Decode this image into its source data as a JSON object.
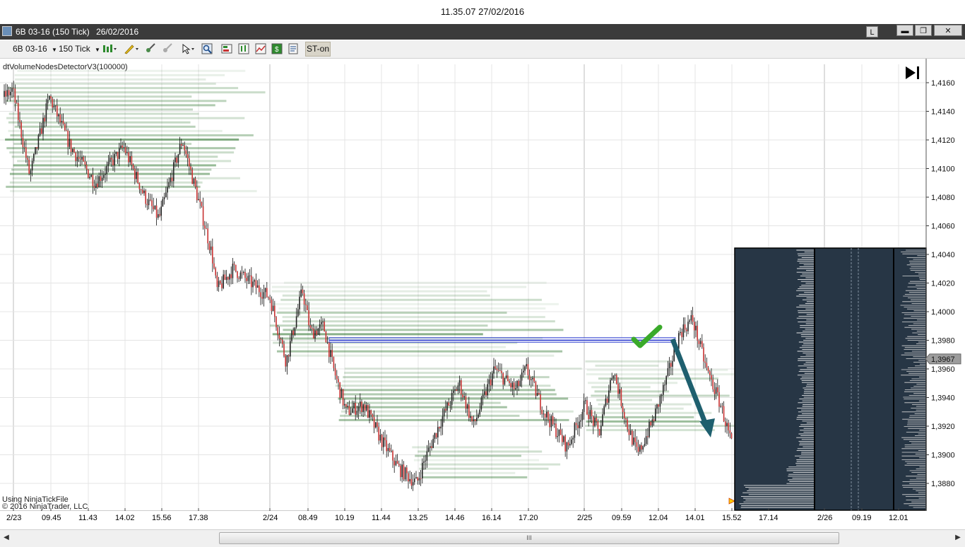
{
  "timestamp": "11.35.07 27/02/2016",
  "window": {
    "title": "6B 03-16 (150 Tick)",
    "date": "26/02/2016",
    "link_button": "L",
    "minimize": "▬",
    "restore": "❐",
    "close": "✕"
  },
  "toolbar": {
    "instrument": "6B 03-16",
    "interval": "150 Tick",
    "st_button": "ST-on",
    "icons": [
      "bars-type-icon",
      "drawing-pencil-icon",
      "crosshair-icon",
      "magnet-icon",
      "pointer-icon",
      "zoom-icon",
      "data-box-icon",
      "chart-style-icon",
      "indicators-icon",
      "strategy-icon",
      "properties-icon"
    ]
  },
  "chart": {
    "indicator_label": "dtVolumeNodesDetectorV3(100000)",
    "data_source": "Using NinjaTickFile",
    "copyright": "© 2016 NinjaTrader, LLC",
    "current_price_label": "1,3967",
    "price_ticks": [
      "1,4160",
      "1,4140",
      "1,4120",
      "1,4100",
      "1,4080",
      "1,4060",
      "1,4040",
      "1,4020",
      "1,4000",
      "1,3980",
      "1,3960",
      "1,3940",
      "1,3920",
      "1,3900",
      "1,3880"
    ],
    "time_ticks": [
      "2/23",
      "09.45",
      "11.43",
      "14.02",
      "15.56",
      "17.38",
      "2/24",
      "08.49",
      "10.19",
      "11.44",
      "13.25",
      "14.46",
      "16.14",
      "17.20",
      "2/25",
      "09.59",
      "12.04",
      "14.01",
      "15.52",
      "17.14",
      "2/26",
      "09.19",
      "12.01"
    ],
    "go_to_end_icon": "go-to-end-icon",
    "colors": {
      "volume_node": "#1d6a1d",
      "level_line": "#2f3fd0",
      "arrow": "#1e5f6e",
      "check": "#3aaa2a",
      "profile_bg": "#273645",
      "candle_up": "#222222",
      "candle_down": "#c83232"
    }
  },
  "scrollbar": {
    "grip": "III"
  }
}
